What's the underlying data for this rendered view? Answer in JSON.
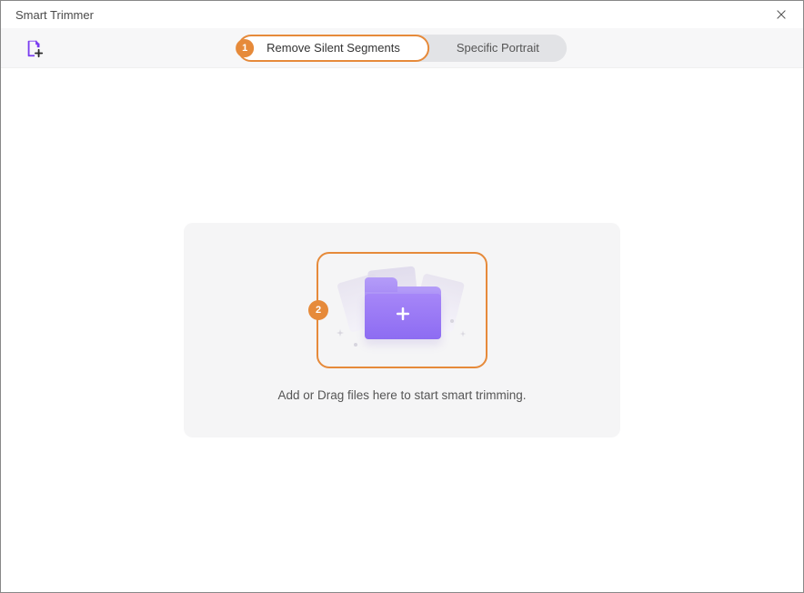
{
  "window": {
    "title": "Smart Trimmer"
  },
  "tabs": {
    "remove_silent": {
      "label": "Remove Silent Segments",
      "step": "1"
    },
    "specific_portrait": {
      "label": "Specific Portrait"
    }
  },
  "dropzone": {
    "step": "2",
    "caption": "Add or Drag files here to start smart trimming."
  }
}
